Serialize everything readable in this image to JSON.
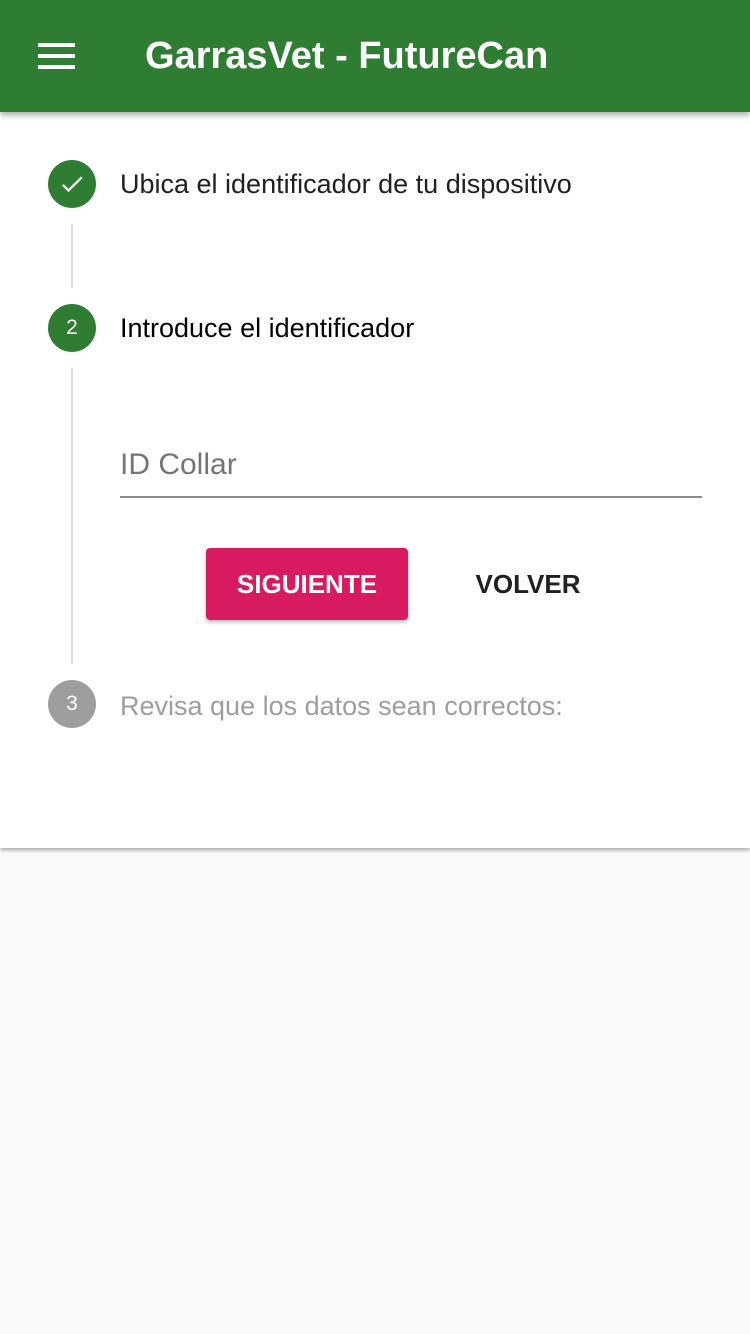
{
  "appbar": {
    "title": "GarrasVet - FutureCan",
    "menu_icon": "menu-icon",
    "color": "#2e7d32"
  },
  "stepper": {
    "steps": [
      {
        "number": "1",
        "label": "Ubica el identificador de tu dispositivo",
        "state": "completed",
        "icon": "check-icon"
      },
      {
        "number": "2",
        "label": "Introduce el identificador",
        "state": "active"
      },
      {
        "number": "3",
        "label": "Revisa que los datos sean correctos:",
        "state": "inactive"
      }
    ],
    "active_step": {
      "id_field": {
        "placeholder": "ID Collar",
        "value": ""
      },
      "next_label": "SIGUIENTE",
      "back_label": "VOLVER"
    }
  },
  "colors": {
    "primary": "#2e7d32",
    "accent": "#d81b60",
    "inactive": "#9e9e9e"
  }
}
